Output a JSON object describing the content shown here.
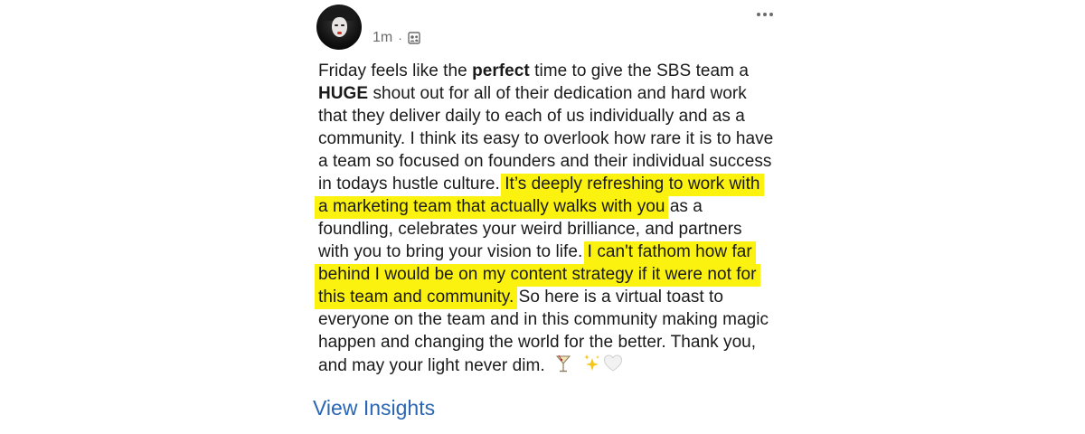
{
  "post": {
    "time_ago": "1m",
    "separator": "·",
    "audience_icon": "connections-icon",
    "more_icon": "more-horizontal-icon",
    "body": {
      "l1a": "Friday feels like the ",
      "l1b": "perfect",
      "l1c": " time to give the SBS team a",
      "l2a": "HUGE",
      "l2b": " shout out for all of their dedication and hard work",
      "l3": "that they deliver daily to each of us individually and as a",
      "l4": "community. I think its easy to overlook how rare it is to have",
      "l5": "a team so focused on founders and their individual success",
      "l6a": "in todays hustle culture. ",
      "l6b": "It’s deeply refreshing to work with",
      "l7a": "a marketing team that actually walks with you",
      "l7b": " as a",
      "l8": "foundling, celebrates your weird brilliance, and partners",
      "l9a": "with you to bring your vision to life. ",
      "l9b": "I can't fathom how far",
      "l10": "behind I would be on my content strategy if it were not for",
      "l11a": "this team and community.",
      "l11b": " So here is a virtual toast to",
      "l12": "everyone on the team and in this community making magic",
      "l13": "happen and changing the world for the better.  Thank you,",
      "l14": "and may your light never dim."
    },
    "emojis": [
      "cocktail-glass-icon",
      "sparkles-icon",
      "white-heart-icon"
    ],
    "highlight_color": "#fbf20f",
    "link_color": "#2a66b3",
    "view_insights": "View Insights"
  }
}
